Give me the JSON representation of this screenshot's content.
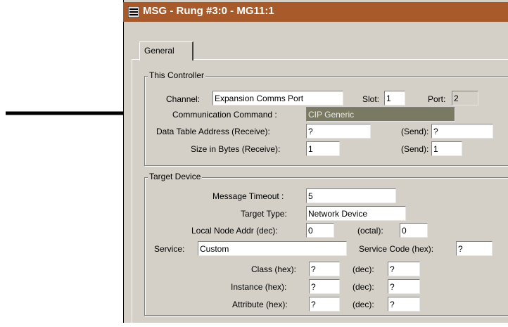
{
  "window": {
    "title": "MSG - Rung #3:0 - MG11:1"
  },
  "tabs": [
    {
      "label": "General"
    }
  ],
  "this_controller": {
    "legend": "This Controller",
    "channel_label": "Channel:",
    "channel_value": "Expansion Comms Port",
    "slot_label": "Slot:",
    "slot_value": "1",
    "port_label": "Port:",
    "port_value": "2",
    "command_label": "Communication Command :",
    "command_value": "CIP Generic",
    "dta_receive_label": "Data Table Address (Receive):",
    "dta_receive_value": "?",
    "dta_send_label": "(Send):",
    "dta_send_value": "?",
    "size_receive_label": "Size in Bytes (Receive):",
    "size_receive_value": "1",
    "size_send_label": "(Send):",
    "size_send_value": "1"
  },
  "target_device": {
    "legend": "Target Device",
    "timeout_label": "Message Timeout :",
    "timeout_value": "5",
    "target_type_label": "Target Type:",
    "target_type_value": "Network Device",
    "local_node_label": "Local Node Addr (dec):",
    "local_node_value": "0",
    "octal_label": "(octal):",
    "octal_value": "0",
    "service_label": "Service:",
    "service_value": "Custom",
    "service_code_label": "Service Code (hex):",
    "service_code_value": "?",
    "class_hex_label": "Class (hex):",
    "class_hex_value": "?",
    "class_dec_label": "(dec):",
    "class_dec_value": "?",
    "instance_hex_label": "Instance (hex):",
    "instance_hex_value": "?",
    "instance_dec_label": "(dec):",
    "instance_dec_value": "?",
    "attribute_hex_label": "Attribute (hex):",
    "attribute_hex_value": "?",
    "attribute_dec_label": "(dec):",
    "attribute_dec_value": "?"
  },
  "colors": {
    "titlebar": "#a85a2a",
    "highlight": "#7a7a62",
    "dialog": "#d4d0c8"
  },
  "icons": {
    "app": "msg-window-icon",
    "pointer": "arrow-pointer-icon"
  }
}
